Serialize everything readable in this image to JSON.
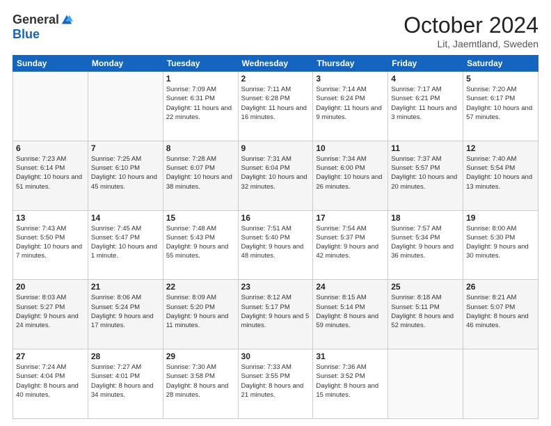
{
  "logo": {
    "general": "General",
    "blue": "Blue"
  },
  "title": "October 2024",
  "subtitle": "Lit, Jaemtland, Sweden",
  "headers": [
    "Sunday",
    "Monday",
    "Tuesday",
    "Wednesday",
    "Thursday",
    "Friday",
    "Saturday"
  ],
  "weeks": [
    [
      {
        "day": "",
        "info": ""
      },
      {
        "day": "",
        "info": ""
      },
      {
        "day": "1",
        "info": "Sunrise: 7:09 AM\nSunset: 6:31 PM\nDaylight: 11 hours and 22 minutes."
      },
      {
        "day": "2",
        "info": "Sunrise: 7:11 AM\nSunset: 6:28 PM\nDaylight: 11 hours and 16 minutes."
      },
      {
        "day": "3",
        "info": "Sunrise: 7:14 AM\nSunset: 6:24 PM\nDaylight: 11 hours and 9 minutes."
      },
      {
        "day": "4",
        "info": "Sunrise: 7:17 AM\nSunset: 6:21 PM\nDaylight: 11 hours and 3 minutes."
      },
      {
        "day": "5",
        "info": "Sunrise: 7:20 AM\nSunset: 6:17 PM\nDaylight: 10 hours and 57 minutes."
      }
    ],
    [
      {
        "day": "6",
        "info": "Sunrise: 7:23 AM\nSunset: 6:14 PM\nDaylight: 10 hours and 51 minutes."
      },
      {
        "day": "7",
        "info": "Sunrise: 7:25 AM\nSunset: 6:10 PM\nDaylight: 10 hours and 45 minutes."
      },
      {
        "day": "8",
        "info": "Sunrise: 7:28 AM\nSunset: 6:07 PM\nDaylight: 10 hours and 38 minutes."
      },
      {
        "day": "9",
        "info": "Sunrise: 7:31 AM\nSunset: 6:04 PM\nDaylight: 10 hours and 32 minutes."
      },
      {
        "day": "10",
        "info": "Sunrise: 7:34 AM\nSunset: 6:00 PM\nDaylight: 10 hours and 26 minutes."
      },
      {
        "day": "11",
        "info": "Sunrise: 7:37 AM\nSunset: 5:57 PM\nDaylight: 10 hours and 20 minutes."
      },
      {
        "day": "12",
        "info": "Sunrise: 7:40 AM\nSunset: 5:54 PM\nDaylight: 10 hours and 13 minutes."
      }
    ],
    [
      {
        "day": "13",
        "info": "Sunrise: 7:43 AM\nSunset: 5:50 PM\nDaylight: 10 hours and 7 minutes."
      },
      {
        "day": "14",
        "info": "Sunrise: 7:45 AM\nSunset: 5:47 PM\nDaylight: 10 hours and 1 minute."
      },
      {
        "day": "15",
        "info": "Sunrise: 7:48 AM\nSunset: 5:43 PM\nDaylight: 9 hours and 55 minutes."
      },
      {
        "day": "16",
        "info": "Sunrise: 7:51 AM\nSunset: 5:40 PM\nDaylight: 9 hours and 48 minutes."
      },
      {
        "day": "17",
        "info": "Sunrise: 7:54 AM\nSunset: 5:37 PM\nDaylight: 9 hours and 42 minutes."
      },
      {
        "day": "18",
        "info": "Sunrise: 7:57 AM\nSunset: 5:34 PM\nDaylight: 9 hours and 36 minutes."
      },
      {
        "day": "19",
        "info": "Sunrise: 8:00 AM\nSunset: 5:30 PM\nDaylight: 9 hours and 30 minutes."
      }
    ],
    [
      {
        "day": "20",
        "info": "Sunrise: 8:03 AM\nSunset: 5:27 PM\nDaylight: 9 hours and 24 minutes."
      },
      {
        "day": "21",
        "info": "Sunrise: 8:06 AM\nSunset: 5:24 PM\nDaylight: 9 hours and 17 minutes."
      },
      {
        "day": "22",
        "info": "Sunrise: 8:09 AM\nSunset: 5:20 PM\nDaylight: 9 hours and 11 minutes."
      },
      {
        "day": "23",
        "info": "Sunrise: 8:12 AM\nSunset: 5:17 PM\nDaylight: 9 hours and 5 minutes."
      },
      {
        "day": "24",
        "info": "Sunrise: 8:15 AM\nSunset: 5:14 PM\nDaylight: 8 hours and 59 minutes."
      },
      {
        "day": "25",
        "info": "Sunrise: 8:18 AM\nSunset: 5:11 PM\nDaylight: 8 hours and 52 minutes."
      },
      {
        "day": "26",
        "info": "Sunrise: 8:21 AM\nSunset: 5:07 PM\nDaylight: 8 hours and 46 minutes."
      }
    ],
    [
      {
        "day": "27",
        "info": "Sunrise: 7:24 AM\nSunset: 4:04 PM\nDaylight: 8 hours and 40 minutes."
      },
      {
        "day": "28",
        "info": "Sunrise: 7:27 AM\nSunset: 4:01 PM\nDaylight: 8 hours and 34 minutes."
      },
      {
        "day": "29",
        "info": "Sunrise: 7:30 AM\nSunset: 3:58 PM\nDaylight: 8 hours and 28 minutes."
      },
      {
        "day": "30",
        "info": "Sunrise: 7:33 AM\nSunset: 3:55 PM\nDaylight: 8 hours and 21 minutes."
      },
      {
        "day": "31",
        "info": "Sunrise: 7:36 AM\nSunset: 3:52 PM\nDaylight: 8 hours and 15 minutes."
      },
      {
        "day": "",
        "info": ""
      },
      {
        "day": "",
        "info": ""
      }
    ]
  ]
}
